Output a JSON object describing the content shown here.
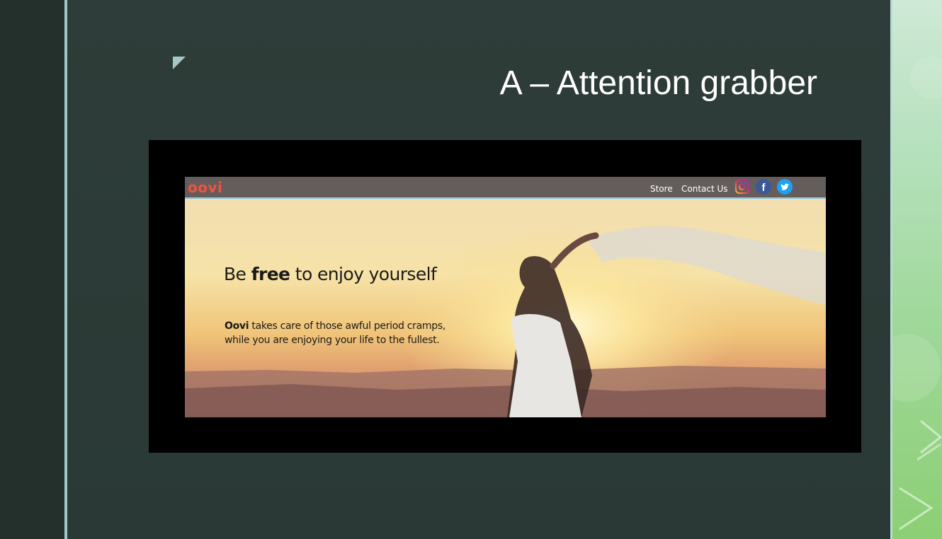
{
  "slide": {
    "title": "A – Attention grabber"
  },
  "website": {
    "logo": "oovi",
    "nav": {
      "store": "Store",
      "contact": "Contact Us"
    },
    "social_icons": [
      "instagram-icon",
      "facebook-icon",
      "twitter-icon"
    ],
    "hero": {
      "headline_pre": "Be ",
      "headline_bold": "free",
      "headline_post": " to enjoy yourself",
      "body_brand": "Oovi",
      "body_line1_rest": " takes care of those awful period cramps,",
      "body_line2": "while you are enjoying your life to the fullest."
    }
  },
  "colors": {
    "slide_background": "#2c3b37",
    "accent_rule": "#9fc9c9",
    "logo": "#f0533f",
    "nav_bar": "#655d5b"
  }
}
